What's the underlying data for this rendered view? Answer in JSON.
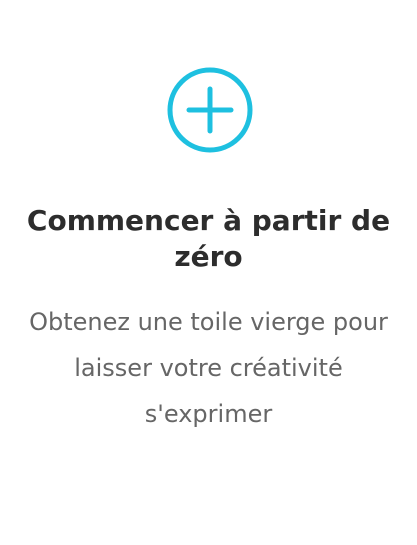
{
  "card": {
    "icon": "plus-circle-icon",
    "accent_color": "#1ec0e0",
    "title": "Commencer à partir de zéro",
    "description": "Obtenez une toile vierge pour laisser votre créativité s'exprimer"
  }
}
